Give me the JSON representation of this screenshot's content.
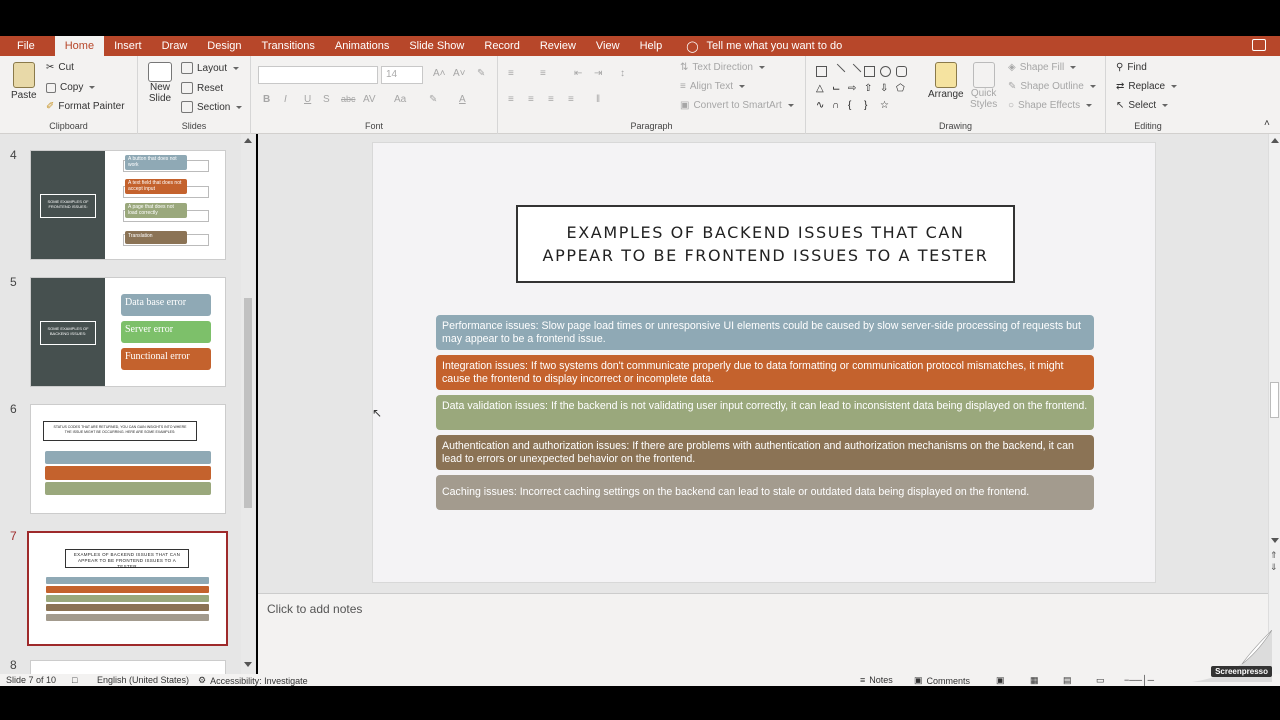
{
  "menu": {
    "items": [
      "File",
      "Home",
      "Insert",
      "Draw",
      "Design",
      "Transitions",
      "Animations",
      "Slide Show",
      "Record",
      "Review",
      "View",
      "Help"
    ],
    "active": "Home",
    "tell_me": "Tell me what you want to do"
  },
  "ribbon": {
    "clipboard": {
      "paste": "Paste",
      "cut": "Cut",
      "copy": "Copy",
      "format_painter": "Format Painter",
      "label": "Clipboard"
    },
    "slides": {
      "new_slide_1": "New",
      "new_slide_2": "Slide",
      "layout": "Layout",
      "reset": "Reset",
      "section": "Section",
      "label": "Slides"
    },
    "font": {
      "size": "14",
      "label": "Font",
      "bold": "B",
      "italic": "I",
      "underline": "U",
      "shadow": "S",
      "strike": "abc",
      "spacing": "AV",
      "case": "Aa"
    },
    "paragraph": {
      "text_direction": "Text Direction",
      "align_text": "Align Text",
      "smartart": "Convert to SmartArt",
      "label": "Paragraph"
    },
    "drawing": {
      "arrange": "Arrange",
      "quick_styles_1": "Quick",
      "quick_styles_2": "Styles",
      "shape_fill": "Shape Fill",
      "shape_outline": "Shape Outline",
      "shape_effects": "Shape Effects",
      "label": "Drawing"
    },
    "editing": {
      "find": "Find",
      "replace": "Replace",
      "select": "Select",
      "label": "Editing"
    }
  },
  "thumbnails": [
    {
      "num": "4",
      "title": "SOME EXAMPLES OF FRONTEND ISSUES:",
      "items": [
        "A button that does not work",
        "A text field that does not accept input",
        "A page that does not load correctly",
        "Translation"
      ]
    },
    {
      "num": "5",
      "title": "SOME EXAMPLES OF BACKEND ISSUES:",
      "items": [
        "Data base error",
        "Server error",
        "Functional error"
      ]
    },
    {
      "num": "6",
      "title": "STATUS CODES THAT ARE RETURNED, YOU CAN GAIN INSIGHTS INTO WHERE THE ISSUE MIGHT BE OCCURRING. HERE ARE SOME EXAMPLES:"
    },
    {
      "num": "7",
      "title": "EXAMPLES OF BACKEND ISSUES THAT CAN APPEAR TO BE FRONTEND ISSUES TO A TESTER"
    },
    {
      "num": "8"
    }
  ],
  "slide": {
    "title_line1": "EXAMPLES OF BACKEND ISSUES THAT CAN",
    "title_line2": "APPEAR TO BE FRONTEND ISSUES TO A TESTER",
    "bullets": [
      {
        "text": "Performance issues: Slow page load times or unresponsive UI elements could be caused by slow server-side processing of requests but may appear to be a frontend issue.",
        "color": "#8fa9b5"
      },
      {
        "text": "Integration issues: If two systems don't communicate properly due to data formatting or communication protocol mismatches, it might cause the frontend to display incorrect or incomplete data.",
        "color": "#c4622d"
      },
      {
        "text": "Data validation issues: If the backend is not validating user input correctly, it can lead to inconsistent data being displayed on the frontend.",
        "color": "#9aa87c"
      },
      {
        "text": "Authentication and authorization issues: If there are problems with authentication and authorization mechanisms on the backend, it can lead to errors or unexpected behavior on the frontend.",
        "color": "#8b7355"
      },
      {
        "text": "Caching issues: Incorrect caching settings on the backend can lead to stale or outdated data being displayed on the frontend.",
        "color": "#a39b8e"
      }
    ]
  },
  "notes_placeholder": "Click to add notes",
  "status": {
    "slide_of": "Slide 7 of 10",
    "language": "English (United States)",
    "accessibility": "Accessibility: Investigate",
    "notes": "Notes",
    "comments": "Comments"
  },
  "watermark": "Screenpresso"
}
